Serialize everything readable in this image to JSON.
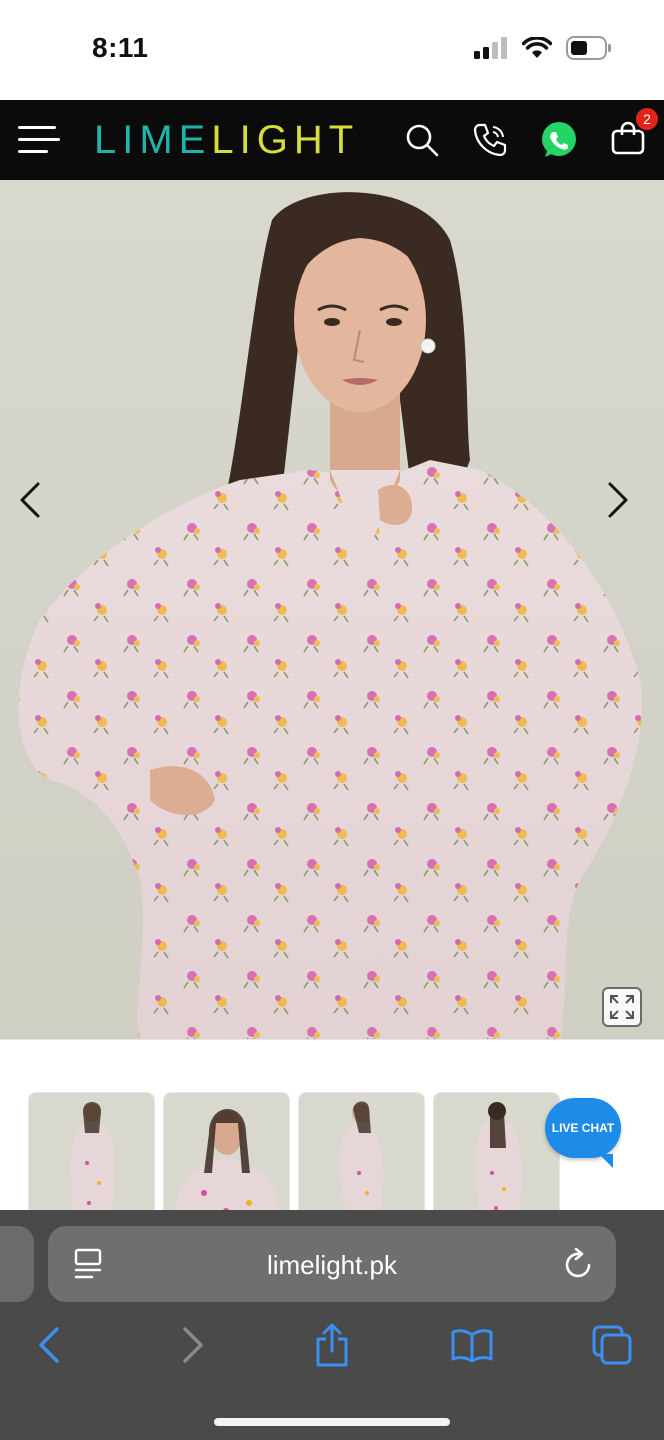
{
  "status_bar": {
    "time": "8:11"
  },
  "header": {
    "menu_icon": "hamburger-icon",
    "logo_part1": "LIME",
    "logo_part2": "LIGHT",
    "cart_count": "2",
    "colors": {
      "background": "#0b0b0b",
      "logo_teal": "#20b4a8",
      "logo_lime": "#d8dd3b",
      "whatsapp": "#25d366",
      "badge": "#e2231a"
    }
  },
  "gallery": {
    "prev_icon": "chevron-left-icon",
    "next_icon": "chevron-right-icon",
    "expand_icon": "expand-icon",
    "thumbnails": [
      {
        "name": "thumb-front"
      },
      {
        "name": "thumb-closeup"
      },
      {
        "name": "thumb-side"
      },
      {
        "name": "thumb-back"
      }
    ]
  },
  "live_chat": {
    "label": "LIVE CHAT",
    "color": "#1f8be8"
  },
  "browser": {
    "url": "limelight.pk",
    "reader_icon": "reader-icon",
    "reload_icon": "reload-icon",
    "toolbar": [
      "back-icon",
      "forward-icon",
      "share-icon",
      "bookmarks-icon",
      "tabs-icon"
    ],
    "accent": "#3b8ff5"
  }
}
